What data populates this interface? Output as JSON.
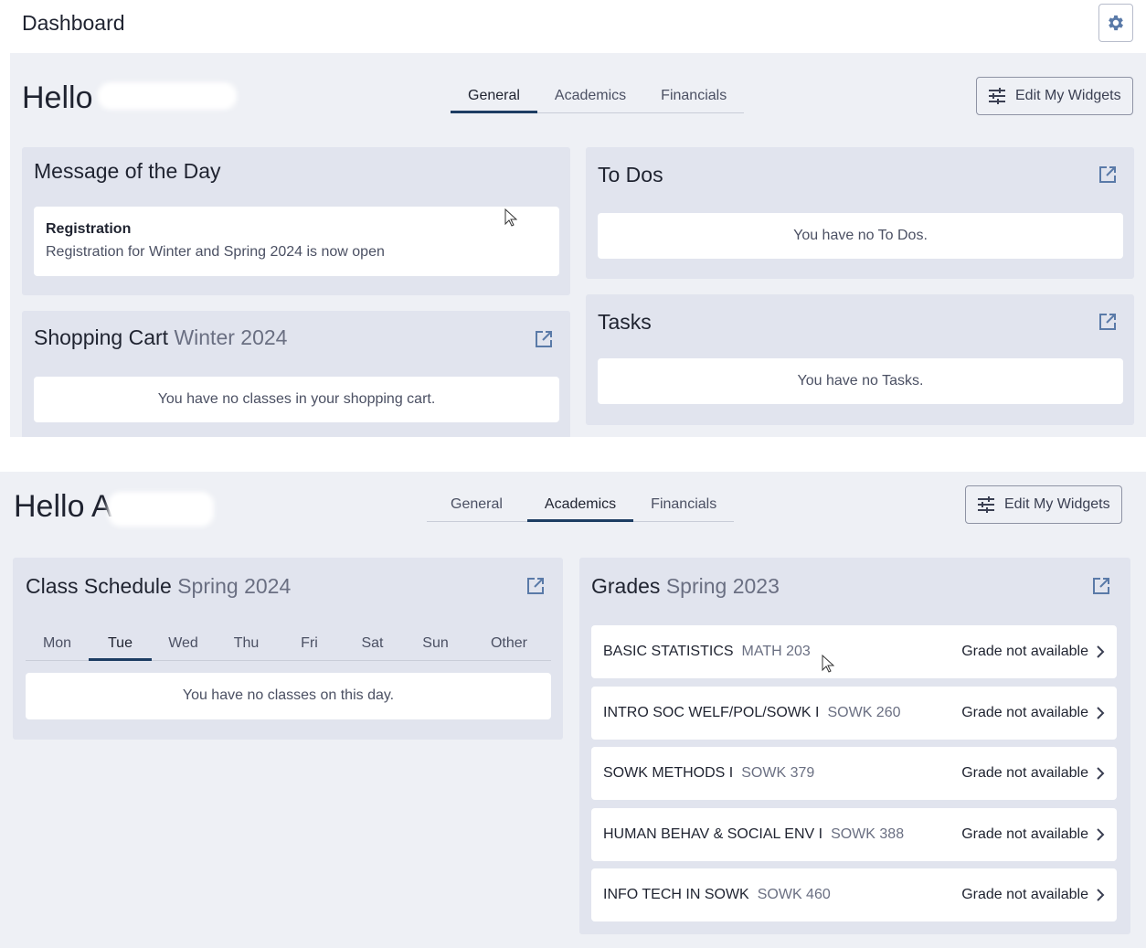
{
  "header": {
    "title": "Dashboard",
    "settings_icon": "gear-icon"
  },
  "top_view": {
    "greeting": "Hello",
    "tabs": [
      {
        "label": "General",
        "active": true
      },
      {
        "label": "Academics",
        "active": false
      },
      {
        "label": "Financials",
        "active": false
      }
    ],
    "edit_button": "Edit My Widgets",
    "message_of_the_day": {
      "title": "Message of the Day",
      "heading": "Registration",
      "body": "Registration for Winter and Spring 2024 is now open"
    },
    "shopping_cart": {
      "title": "Shopping Cart",
      "term": "Winter 2024",
      "empty": "You have no classes in your shopping cart."
    },
    "todos": {
      "title": "To Dos",
      "empty": "You have no To Dos."
    },
    "tasks": {
      "title": "Tasks",
      "empty": "You have no Tasks."
    }
  },
  "bottom_view": {
    "greeting": "Hello A",
    "tabs": [
      {
        "label": "General",
        "active": false
      },
      {
        "label": "Academics",
        "active": true
      },
      {
        "label": "Financials",
        "active": false
      }
    ],
    "edit_button": "Edit My Widgets",
    "class_schedule": {
      "title": "Class Schedule",
      "term": "Spring 2024",
      "days": [
        "Mon",
        "Tue",
        "Wed",
        "Thu",
        "Fri",
        "Sat",
        "Sun",
        "Other"
      ],
      "active_day": "Tue",
      "empty": "You have no classes on this day."
    },
    "grades": {
      "title": "Grades",
      "term": "Spring 2023",
      "rows": [
        {
          "course": "BASIC STATISTICS",
          "code": "MATH 203",
          "status": "Grade not available"
        },
        {
          "course": "INTRO SOC WELF/POL/SOWK I",
          "code": "SOWK 260",
          "status": "Grade not available"
        },
        {
          "course": "SOWK METHODS I",
          "code": "SOWK 379",
          "status": "Grade not available"
        },
        {
          "course": "HUMAN BEHAV & SOCIAL ENV I",
          "code": "SOWK 388",
          "status": "Grade not available"
        },
        {
          "course": "INFO TECH IN SOWK",
          "code": "SOWK 460",
          "status": "Grade not available"
        }
      ]
    }
  },
  "colors": {
    "accent": "#1d3d63",
    "panel_bg": "#eef0f5",
    "card_bg": "#e1e4ee",
    "icon": "#5a7aa8"
  }
}
